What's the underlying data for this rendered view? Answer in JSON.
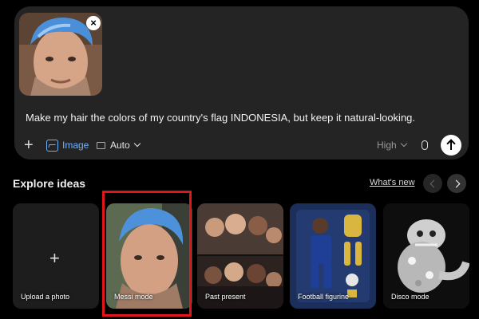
{
  "composer": {
    "prompt_text": "Make my hair the colors of my country's flag INDONESIA, but keep it natural-looking.",
    "attachment_close_icon": "close-icon",
    "toolbar": {
      "plus_icon": "plus-icon",
      "image_label": "Image",
      "aspect_label": "Auto",
      "quality_label": "High",
      "mic_icon": "microphone-icon",
      "send_icon": "arrow-up-icon"
    }
  },
  "explore": {
    "title": "Explore ideas",
    "whats_new": "What's new",
    "cards": [
      {
        "label": "Upload a photo"
      },
      {
        "label": "Messi mode"
      },
      {
        "label": "Past present"
      },
      {
        "label": "Football figurine"
      },
      {
        "label": "Disco mode"
      }
    ]
  },
  "colors": {
    "background": "#000000",
    "composer_bg": "#242424",
    "accent_blue": "#6fb1ff",
    "selection_red": "#e0161b"
  }
}
